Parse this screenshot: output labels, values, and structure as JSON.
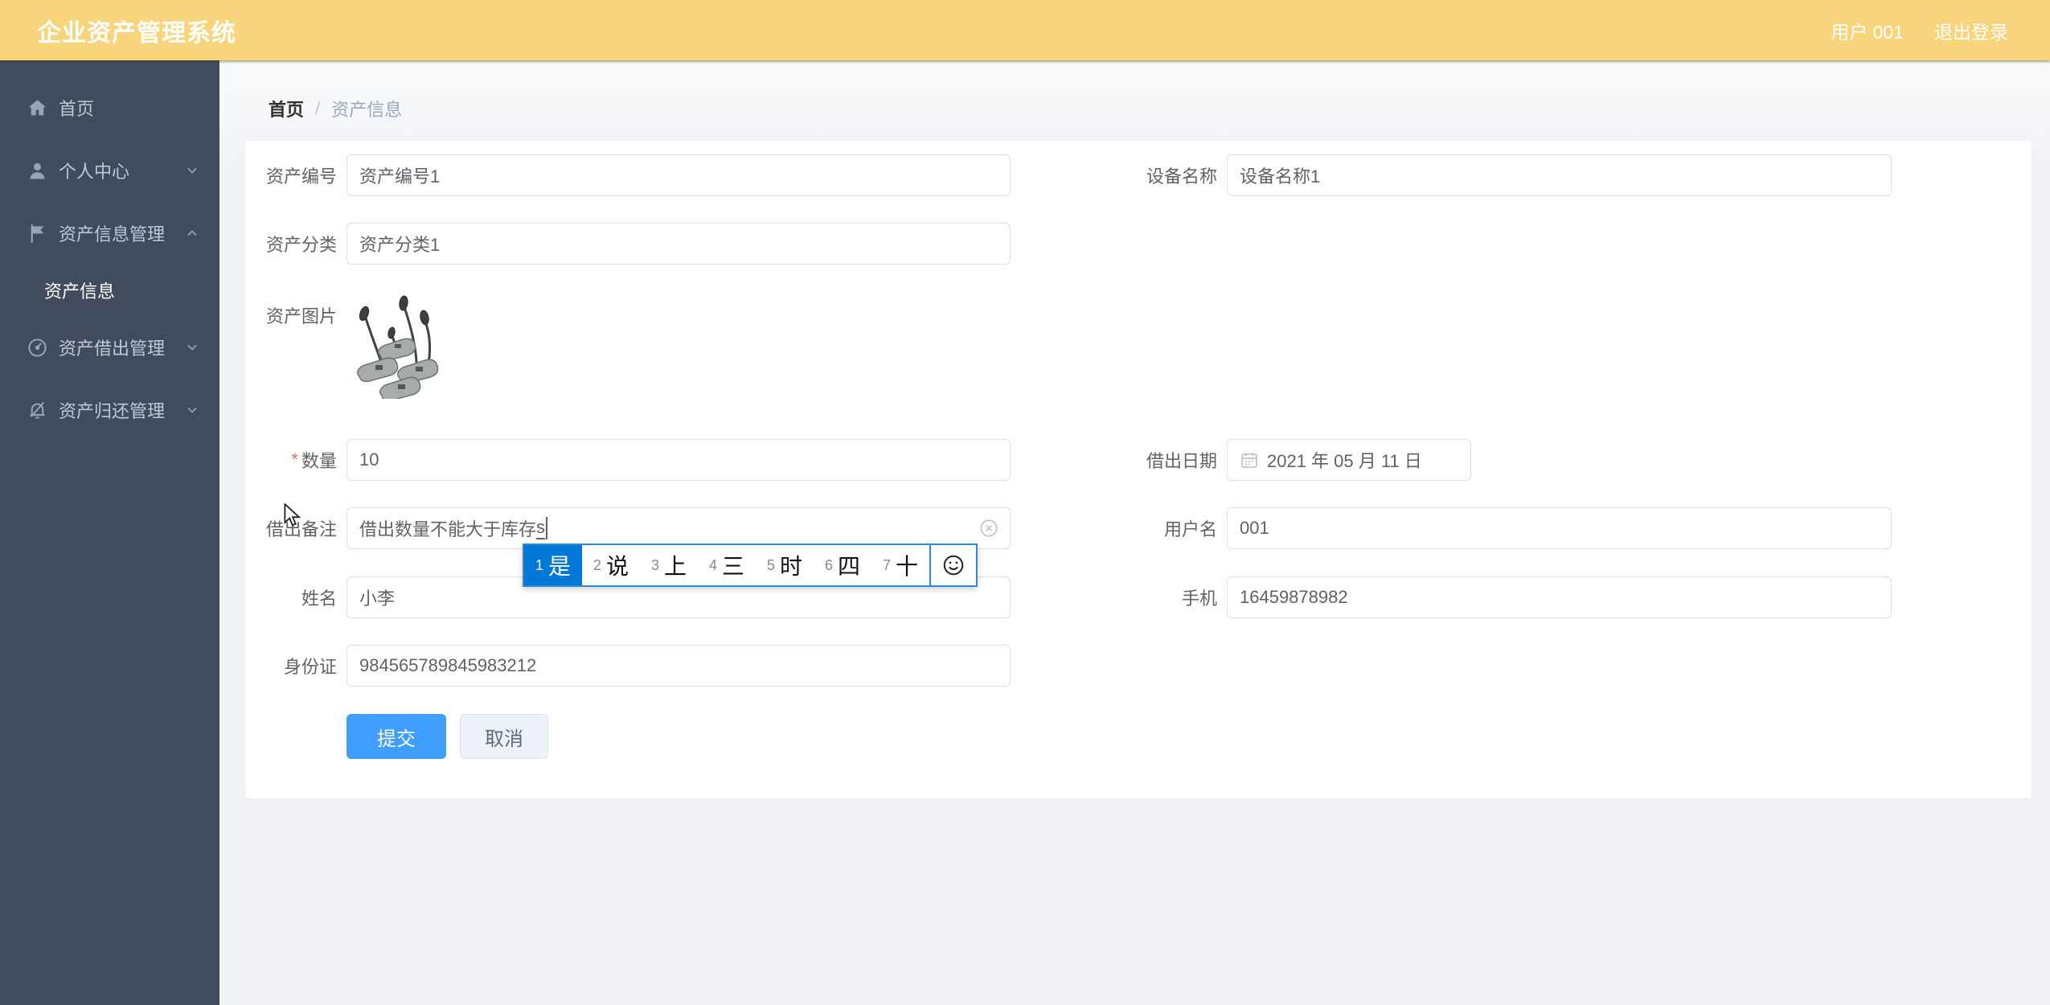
{
  "colors": {
    "header_bg": "#f8d57c",
    "sidebar_bg": "#424b5d",
    "accent": "#409eff",
    "ime_selected": "#0078d7"
  },
  "header": {
    "title": "企业资产管理系统",
    "user": "用户 001",
    "logout": "退出登录"
  },
  "sidebar": {
    "items": [
      {
        "label": "首页",
        "icon": "home-icon"
      },
      {
        "label": "个人中心",
        "icon": "user-icon",
        "chevron": "down"
      },
      {
        "label": "资产信息管理",
        "icon": "flag-icon",
        "chevron": "up"
      },
      {
        "label": "资产信息",
        "submenu": true,
        "active": true
      },
      {
        "label": "资产借出管理",
        "icon": "odometer-icon",
        "chevron": "down"
      },
      {
        "label": "资产归还管理",
        "icon": "bell-off-icon",
        "chevron": "down"
      }
    ]
  },
  "breadcrumb": {
    "home": "首页",
    "separator": "/",
    "current": "资产信息"
  },
  "form": {
    "required_mark": "*",
    "fields": {
      "asset_no": {
        "label": "资产编号",
        "value": "资产编号1"
      },
      "device_name": {
        "label": "设备名称",
        "value": "设备名称1"
      },
      "asset_category": {
        "label": "资产分类",
        "value": "资产分类1"
      },
      "asset_image": {
        "label": "资产图片"
      },
      "quantity": {
        "label": "数量",
        "value": "10"
      },
      "lend_date": {
        "label": "借出日期",
        "value": "2021 年 05 月 11 日"
      },
      "lend_note": {
        "label": "借出备注",
        "value": "借出数量不能大于库存",
        "composing": "s"
      },
      "username": {
        "label": "用户名",
        "value": "001"
      },
      "name": {
        "label": "姓名",
        "value": "小李"
      },
      "phone": {
        "label": "手机",
        "value": "16459878982"
      },
      "id_card": {
        "label": "身份证",
        "value": "984565789845983212"
      }
    },
    "buttons": {
      "submit": "提交",
      "cancel": "取消"
    }
  },
  "ime": {
    "candidates": [
      {
        "num": "1",
        "char": "是"
      },
      {
        "num": "2",
        "char": "说"
      },
      {
        "num": "3",
        "char": "上"
      },
      {
        "num": "4",
        "char": "三"
      },
      {
        "num": "5",
        "char": "时"
      },
      {
        "num": "6",
        "char": "四"
      },
      {
        "num": "7",
        "char": "十"
      }
    ]
  }
}
